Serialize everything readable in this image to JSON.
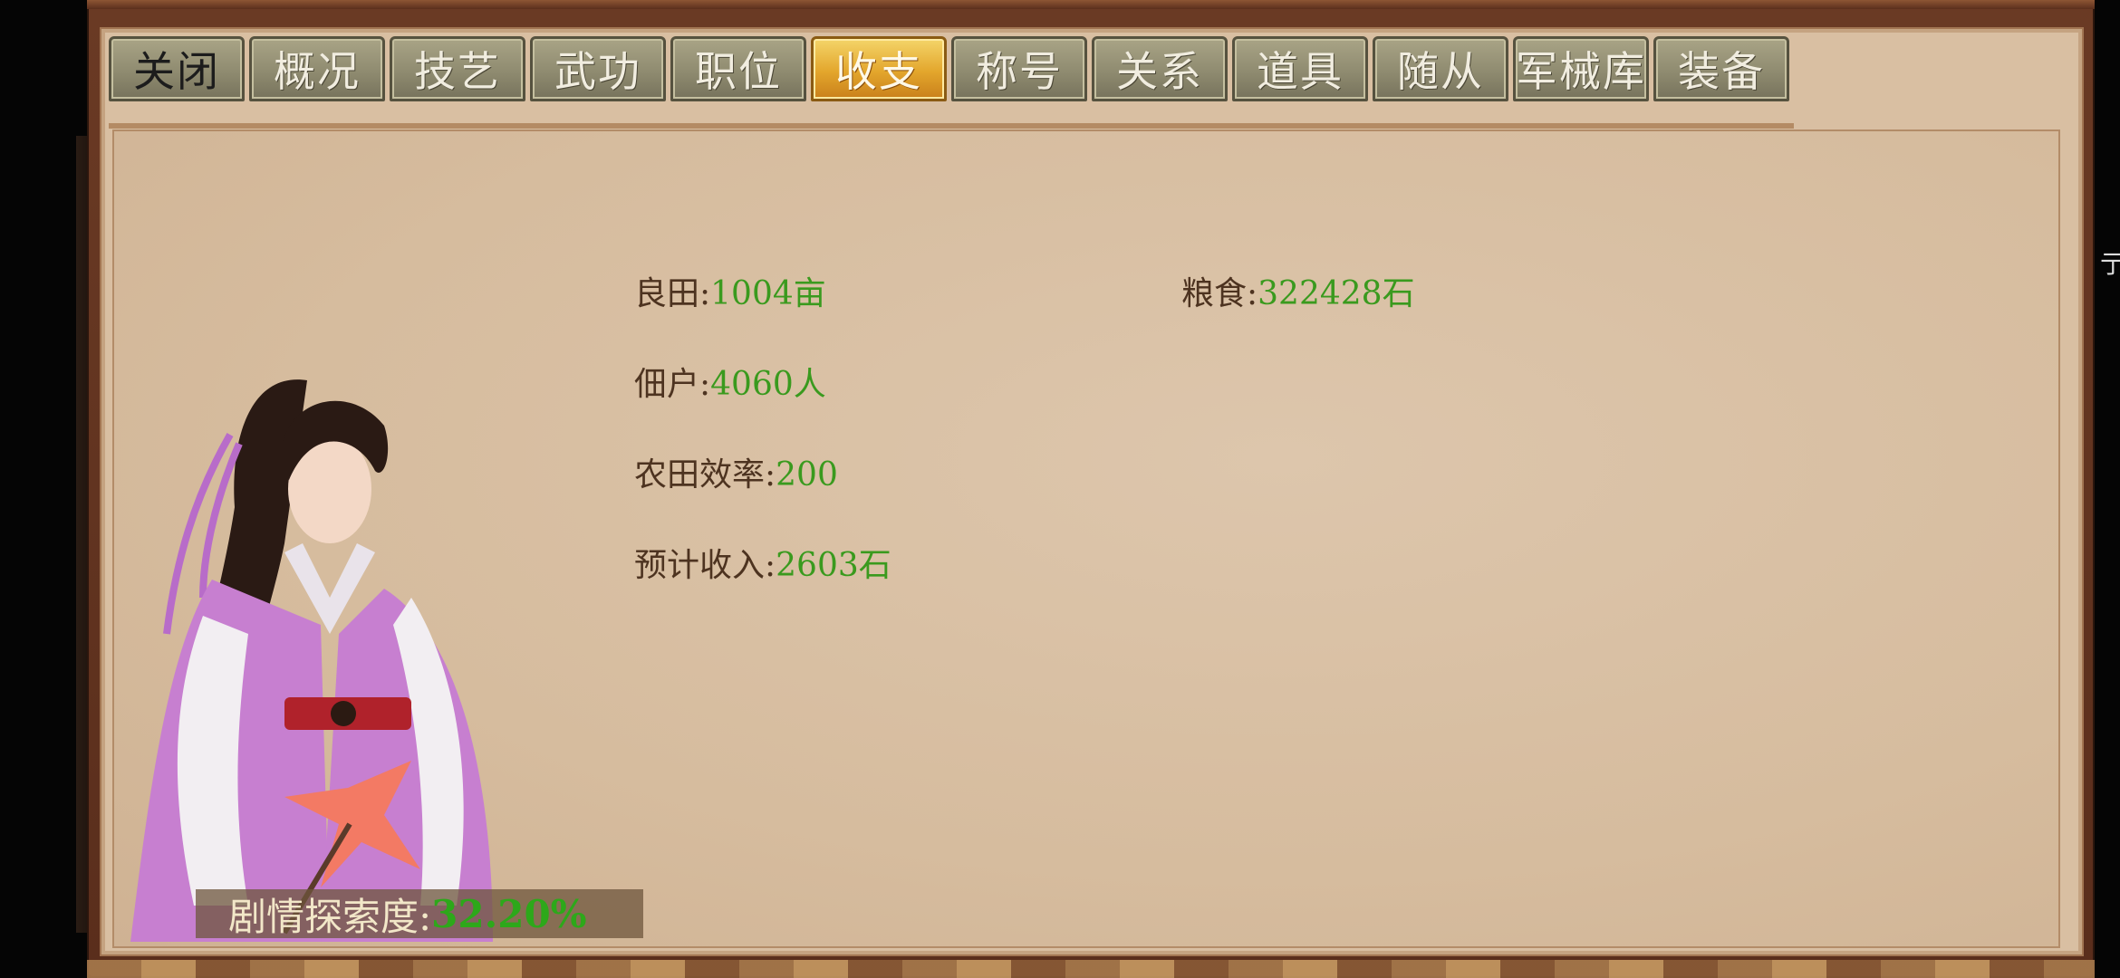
{
  "tabs": [
    {
      "label": "关闭",
      "name": "tab-close",
      "active": false
    },
    {
      "label": "概况",
      "name": "tab-overview",
      "active": false
    },
    {
      "label": "技艺",
      "name": "tab-skills",
      "active": false
    },
    {
      "label": "武功",
      "name": "tab-martial-arts",
      "active": false
    },
    {
      "label": "职位",
      "name": "tab-position",
      "active": false
    },
    {
      "label": "收支",
      "name": "tab-income",
      "active": true
    },
    {
      "label": "称号",
      "name": "tab-titles",
      "active": false
    },
    {
      "label": "关系",
      "name": "tab-relations",
      "active": false
    },
    {
      "label": "道具",
      "name": "tab-items",
      "active": false
    },
    {
      "label": "随从",
      "name": "tab-followers",
      "active": false
    },
    {
      "label": "军械库",
      "name": "tab-armory",
      "active": false
    },
    {
      "label": "装备",
      "name": "tab-equipment",
      "active": false
    }
  ],
  "stats": {
    "farmland": {
      "label": "良田:",
      "value": "1004亩"
    },
    "grain": {
      "label": "粮食:",
      "value": "322428石"
    },
    "tenants": {
      "label": "佃户:",
      "value": "4060人"
    },
    "efficiency": {
      "label": "农田效率:",
      "value": "200"
    },
    "expected_income": {
      "label": "预计收入:",
      "value": "2603石"
    }
  },
  "progress": {
    "label": "剧情探索度:",
    "value": "32.20%"
  },
  "right_edge_glyph": "亍",
  "colors": {
    "value_green": "#3a9a1e",
    "label_brown": "#4d3320",
    "active_tab_gold": "#e3a62c",
    "tab_gray": "#8f8b70",
    "character_robe": "#c77fd0"
  }
}
